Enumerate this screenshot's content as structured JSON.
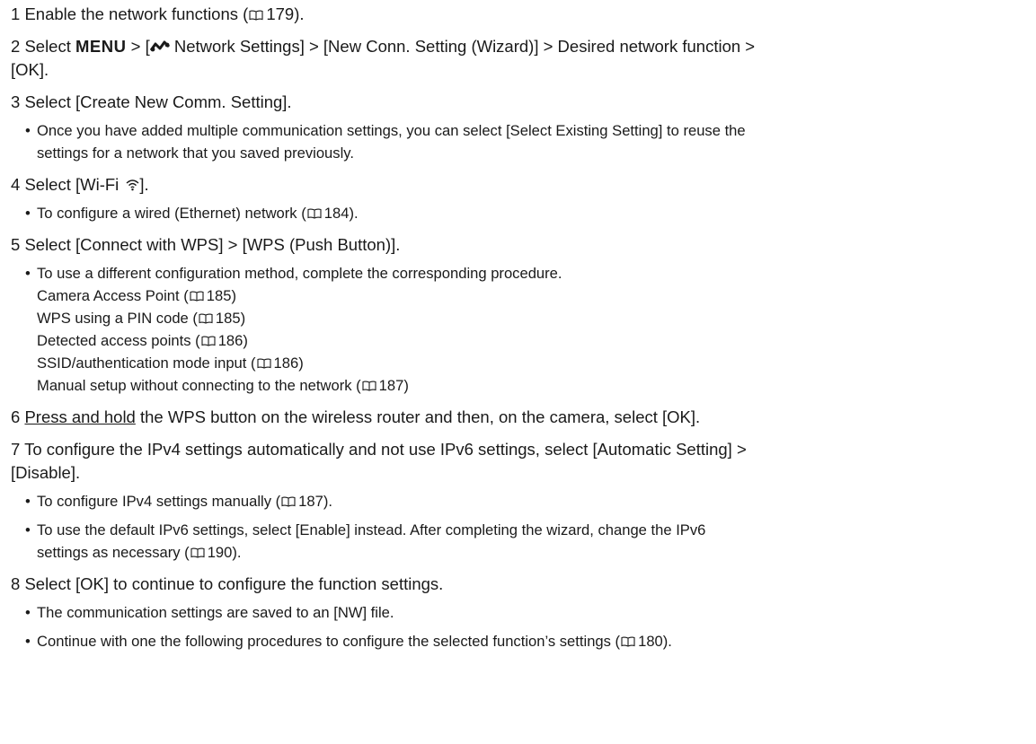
{
  "icons": {
    "book": "book-reference-icon",
    "network": "network-settings-icon",
    "wifi": "wifi-icon"
  },
  "steps": [
    {
      "num": "1",
      "pre": "Enable the network functions (",
      "ref": "179",
      "post": ")."
    },
    {
      "num": "2",
      "pre": "Select ",
      "menu": "MENU",
      "mid": " > [",
      "mid2": " Network Settings] > [New Conn. Setting (Wizard)] > Desired network function >",
      "line2": "[OK]."
    },
    {
      "num": "3",
      "text": "Select [Create New Comm. Setting].",
      "bullet_l1": "Once you have added multiple communication settings, you can select [Select Existing Setting] to reuse the",
      "bullet_l2": "settings for a network that you saved previously."
    },
    {
      "num": "4",
      "pre": "Select [Wi-Fi ",
      "post": "].",
      "bullet_pre": "To configure a wired (Ethernet) network (",
      "bullet_ref": "184",
      "bullet_post": ")."
    },
    {
      "num": "5",
      "text": "Select [Connect with WPS] > [WPS (Push Button)].",
      "bullet_first": "To use a different configuration method, complete the corresponding procedure.",
      "methods": [
        {
          "label": "Camera Access Point (",
          "ref": "185",
          "close": ")"
        },
        {
          "label": "WPS using a PIN code (",
          "ref": "185",
          "close": ")"
        },
        {
          "label": "Detected access points (",
          "ref": "186",
          "close": ")"
        },
        {
          "label": "SSID/authentication mode input (",
          "ref": "186",
          "close": ")"
        },
        {
          "label": "Manual setup without connecting to the network (",
          "ref": "187",
          "close": ")"
        }
      ]
    },
    {
      "num": "6",
      "underlined": "Press and hold",
      "rest": " the WPS button on the wireless router and then, on the camera, select [OK]."
    },
    {
      "num": "7",
      "line1": "To configure the IPv4 settings automatically and not use IPv6 settings, select [Automatic Setting] >",
      "line2": "[Disable].",
      "b1_pre": "To configure IPv4 settings manually (",
      "b1_ref": "187",
      "b1_post": ").",
      "b2_l1": "To use the default IPv6 settings, select [Enable] instead. After completing the wizard, change the IPv6",
      "b2_l2_pre": "settings as necessary (",
      "b2_ref": "190",
      "b2_post": ")."
    },
    {
      "num": "8",
      "text": "Select [OK] to continue to configure the function settings.",
      "b1": "The communication settings are saved to an [NW] file.",
      "b2_pre": "Continue with one the following procedures to configure the selected function’s settings (",
      "b2_ref": "180",
      "b2_post": ")."
    }
  ]
}
